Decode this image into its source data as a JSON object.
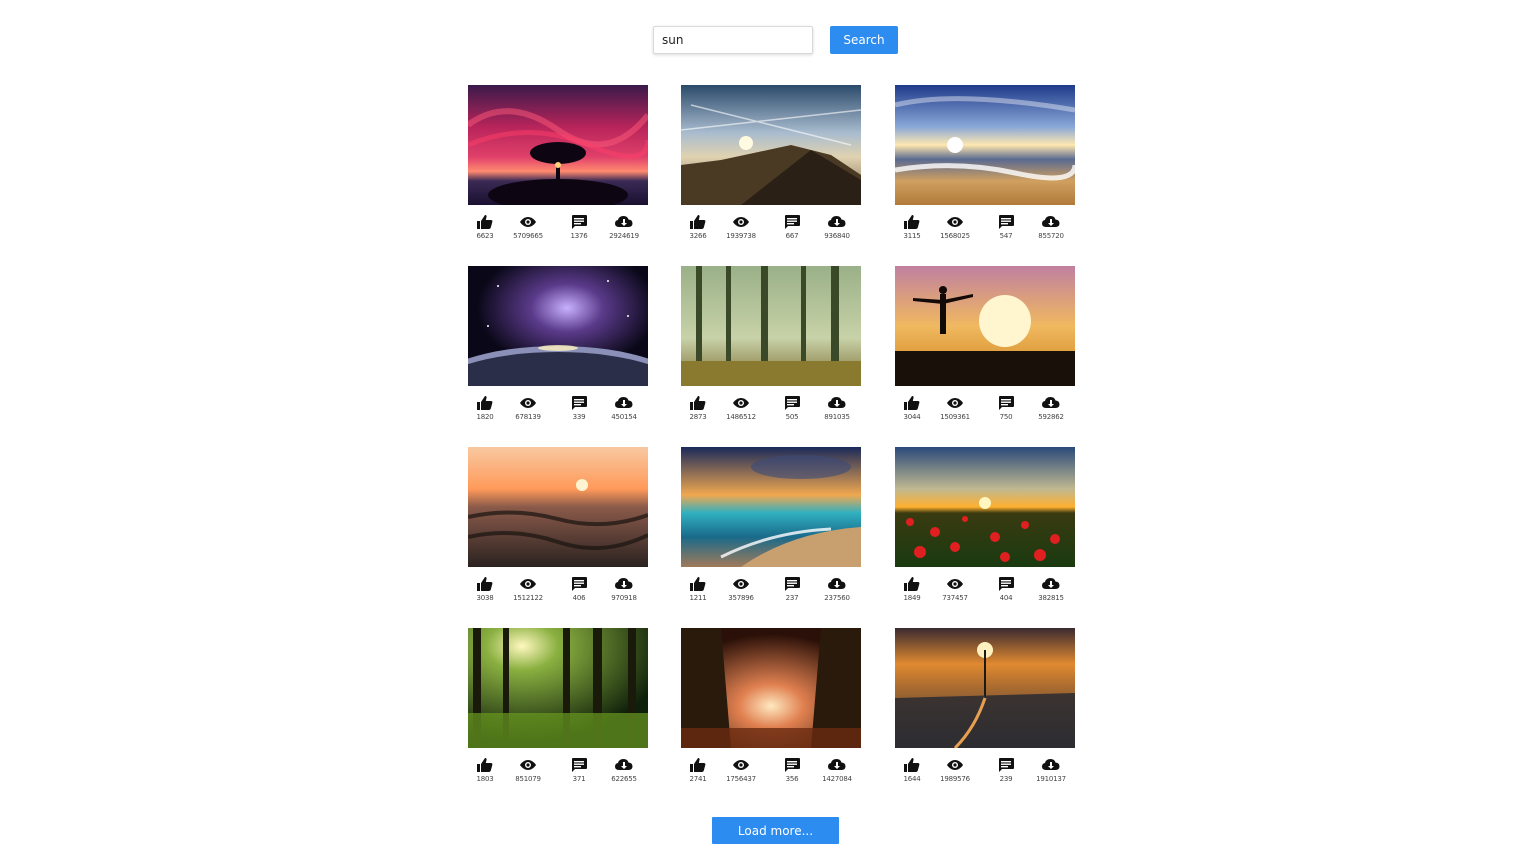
{
  "search": {
    "value": "sun",
    "button_label": "Search"
  },
  "results": [
    {
      "image": "red-sky-tree-silhouette",
      "likes": "6623",
      "views": "5709665",
      "comments": "1376",
      "downloads": "2924619"
    },
    {
      "image": "mountain-ridge-sunrise-clouds",
      "likes": "3266",
      "views": "1939738",
      "comments": "667",
      "downloads": "936840"
    },
    {
      "image": "beach-waves-sunset",
      "likes": "3115",
      "views": "1568025",
      "comments": "547",
      "downloads": "855720"
    },
    {
      "image": "galaxy-over-planet",
      "likes": "1820",
      "views": "678139",
      "comments": "339",
      "downloads": "450154"
    },
    {
      "image": "misty-forest-sunlight",
      "likes": "2873",
      "views": "1486512",
      "comments": "505",
      "downloads": "891035"
    },
    {
      "image": "woman-silhouette-sunset-pier",
      "likes": "3044",
      "views": "1509361",
      "comments": "750",
      "downloads": "592862"
    },
    {
      "image": "ocean-waves-orange-sunset",
      "likes": "3038",
      "views": "1512122",
      "comments": "406",
      "downloads": "970918"
    },
    {
      "image": "tropical-beach-sunset",
      "likes": "1211",
      "views": "357896",
      "comments": "237",
      "downloads": "237560"
    },
    {
      "image": "poppy-field-sunset",
      "likes": "1849",
      "views": "737457",
      "comments": "404",
      "downloads": "382815"
    },
    {
      "image": "forest-sunrays-green",
      "likes": "1803",
      "views": "851079",
      "comments": "371",
      "downloads": "622655"
    },
    {
      "image": "autumn-forest-path-light",
      "likes": "2741",
      "views": "1756437",
      "comments": "356",
      "downloads": "1427084"
    },
    {
      "image": "city-skyline-sunset",
      "likes": "1644",
      "views": "1989576",
      "comments": "239",
      "downloads": "1910137"
    }
  ],
  "stat_icons": [
    "thumbs-up-icon",
    "eye-icon",
    "comment-icon",
    "cloud-download-icon"
  ],
  "load_more_label": "Load more...",
  "colors": {
    "accent": "#2d8cf0",
    "icon": "#111111"
  }
}
